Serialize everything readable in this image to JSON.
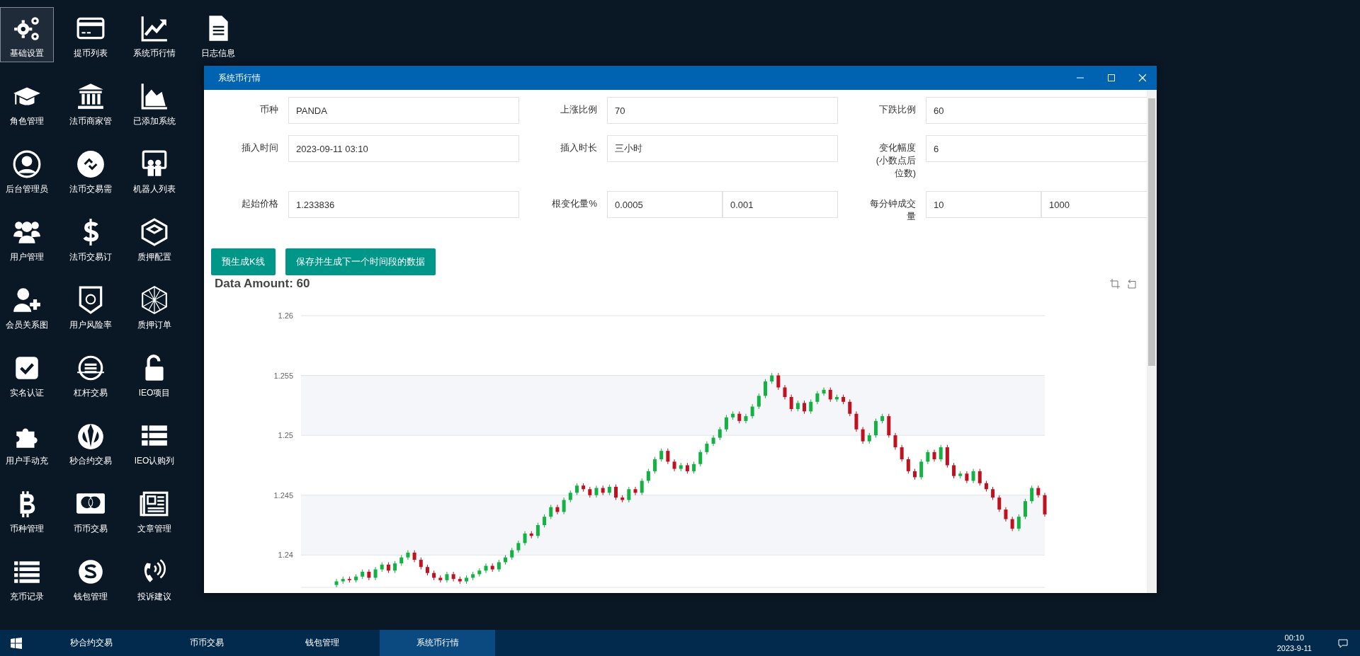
{
  "desktop_icons": [
    [
      {
        "label": "基础设置",
        "selected": true
      },
      {
        "label": "提币列表",
        "selected": false
      },
      {
        "label": "系统币行情",
        "selected": false
      },
      {
        "label": "日志信息",
        "selected": false
      }
    ],
    [
      {
        "label": "角色管理",
        "selected": false
      },
      {
        "label": "法币商家管",
        "selected": false
      },
      {
        "label": "已添加系统",
        "selected": false
      }
    ],
    [
      {
        "label": "后台管理员",
        "selected": false
      },
      {
        "label": "法币交易需",
        "selected": false
      },
      {
        "label": "机器人列表",
        "selected": false
      }
    ],
    [
      {
        "label": "用户管理",
        "selected": false
      },
      {
        "label": "法币交易订",
        "selected": false
      },
      {
        "label": "质押配置",
        "selected": false
      }
    ],
    [
      {
        "label": "会员关系图",
        "selected": false
      },
      {
        "label": "用户风险率",
        "selected": false
      },
      {
        "label": "质押订单",
        "selected": false
      }
    ],
    [
      {
        "label": "实名认证",
        "selected": false
      },
      {
        "label": "杠杆交易",
        "selected": false
      },
      {
        "label": "IEO项目",
        "selected": false
      }
    ],
    [
      {
        "label": "用户手动充",
        "selected": false
      },
      {
        "label": "秒合约交易",
        "selected": false
      },
      {
        "label": "IEO认购列",
        "selected": false
      }
    ],
    [
      {
        "label": "币种管理",
        "selected": false
      },
      {
        "label": "币币交易",
        "selected": false
      },
      {
        "label": "文章管理",
        "selected": false
      }
    ],
    [
      {
        "label": "充币记录",
        "selected": false
      },
      {
        "label": "钱包管理",
        "selected": false
      },
      {
        "label": "投诉建议",
        "selected": false
      }
    ]
  ],
  "window": {
    "title": "系统币行情",
    "form": [
      [
        {
          "label": "币种",
          "values": [
            "PANDA"
          ]
        },
        {
          "label": "上涨比例",
          "values": [
            "70"
          ]
        },
        {
          "label": "下跌比例",
          "values": [
            "60"
          ]
        }
      ],
      [
        {
          "label": "插入时间",
          "values": [
            "2023-09-11 03:10"
          ]
        },
        {
          "label": "插入时长",
          "values": [
            "三小时"
          ]
        },
        {
          "label": "变化幅度 (小数点后位数)",
          "values": [
            "6"
          ]
        }
      ],
      [
        {
          "label": "起始价格",
          "values": [
            "1.233836"
          ]
        },
        {
          "label": "根变化量%",
          "values": [
            "0.0005",
            "0.001"
          ]
        },
        {
          "label": "每分钟成交量",
          "values": [
            "10",
            "1000"
          ]
        }
      ]
    ],
    "buttons": [
      "预生成K线",
      "保存并生成下一个时间段的数据"
    ],
    "chart_data": {
      "type": "candlestick",
      "title": "Data Amount: 60",
      "grid": true,
      "ylim": [
        1.2373,
        1.26
      ],
      "yticks": [
        1.24,
        1.245,
        1.25,
        1.255,
        1.26
      ],
      "bands": [
        {
          "axis": "y",
          "from": 1.25,
          "to": 1.255
        },
        {
          "axis": "y",
          "from": 1.24,
          "to": 1.245
        }
      ],
      "ohlc": [
        [
          1.2375,
          1.238,
          1.2373,
          1.2378
        ],
        [
          1.2378,
          1.2382,
          1.2376,
          1.238
        ],
        [
          1.238,
          1.2382,
          1.2377,
          1.2379
        ],
        [
          1.2379,
          1.2384,
          1.2377,
          1.2382
        ],
        [
          1.2382,
          1.2388,
          1.238,
          1.2386
        ],
        [
          1.2386,
          1.2388,
          1.2379,
          1.2381
        ],
        [
          1.2381,
          1.239,
          1.2379,
          1.2388
        ],
        [
          1.2388,
          1.2394,
          1.2386,
          1.2392
        ],
        [
          1.2392,
          1.2394,
          1.2385,
          1.2387
        ],
        [
          1.2387,
          1.2395,
          1.2385,
          1.2393
        ],
        [
          1.2393,
          1.24,
          1.2391,
          1.2398
        ],
        [
          1.2398,
          1.2404,
          1.2396,
          1.2402
        ],
        [
          1.2402,
          1.2404,
          1.2394,
          1.2396
        ],
        [
          1.2396,
          1.2398,
          1.2388,
          1.239
        ],
        [
          1.239,
          1.2392,
          1.2383,
          1.2385
        ],
        [
          1.2385,
          1.2387,
          1.2379,
          1.2381
        ],
        [
          1.2381,
          1.2383,
          1.2377,
          1.2379
        ],
        [
          1.2379,
          1.2386,
          1.2377,
          1.2384
        ],
        [
          1.2384,
          1.2386,
          1.2378,
          1.238
        ],
        [
          1.238,
          1.2382,
          1.2376,
          1.2378
        ],
        [
          1.2378,
          1.2383,
          1.2376,
          1.2381
        ],
        [
          1.2381,
          1.2386,
          1.2379,
          1.2384
        ],
        [
          1.2384,
          1.2389,
          1.2382,
          1.2387
        ],
        [
          1.2387,
          1.2393,
          1.2385,
          1.2391
        ],
        [
          1.2391,
          1.2393,
          1.2386,
          1.2388
        ],
        [
          1.2388,
          1.2396,
          1.2386,
          1.2394
        ],
        [
          1.2394,
          1.24,
          1.2392,
          1.2398
        ],
        [
          1.2398,
          1.2406,
          1.2396,
          1.2404
        ],
        [
          1.2404,
          1.2412,
          1.2402,
          1.241
        ],
        [
          1.241,
          1.242,
          1.2408,
          1.2418
        ],
        [
          1.2418,
          1.242,
          1.2414,
          1.2416
        ],
        [
          1.2416,
          1.2427,
          1.2414,
          1.2425
        ],
        [
          1.2425,
          1.2434,
          1.2423,
          1.2432
        ],
        [
          1.2432,
          1.2442,
          1.243,
          1.244
        ],
        [
          1.244,
          1.2442,
          1.2434,
          1.2436
        ],
        [
          1.2436,
          1.2448,
          1.2434,
          1.2446
        ],
        [
          1.2446,
          1.2454,
          1.2444,
          1.2452
        ],
        [
          1.2452,
          1.246,
          1.245,
          1.2458
        ],
        [
          1.2458,
          1.246,
          1.2453,
          1.2455
        ],
        [
          1.2455,
          1.2457,
          1.2448,
          1.245
        ],
        [
          1.245,
          1.2458,
          1.2448,
          1.2456
        ],
        [
          1.2456,
          1.2458,
          1.245,
          1.2452
        ],
        [
          1.2452,
          1.2459,
          1.245,
          1.2457
        ],
        [
          1.2457,
          1.2459,
          1.2446,
          1.2448
        ],
        [
          1.2448,
          1.245,
          1.2444,
          1.2446
        ],
        [
          1.2446,
          1.2457,
          1.2444,
          1.2455
        ],
        [
          1.2455,
          1.2457,
          1.245,
          1.2452
        ],
        [
          1.2452,
          1.2464,
          1.245,
          1.2462
        ],
        [
          1.2462,
          1.2472,
          1.246,
          1.247
        ],
        [
          1.247,
          1.2482,
          1.2468,
          1.248
        ],
        [
          1.248,
          1.2489,
          1.2478,
          1.2487
        ],
        [
          1.2487,
          1.2489,
          1.2476,
          1.2478
        ],
        [
          1.2478,
          1.248,
          1.247,
          1.2472
        ],
        [
          1.2472,
          1.2477,
          1.247,
          1.2475
        ],
        [
          1.2475,
          1.2477,
          1.2468,
          1.247
        ],
        [
          1.247,
          1.2478,
          1.2468,
          1.2476
        ],
        [
          1.2476,
          1.2488,
          1.2474,
          1.2486
        ],
        [
          1.2486,
          1.2495,
          1.2484,
          1.2493
        ],
        [
          1.2493,
          1.25,
          1.2491,
          1.2498
        ],
        [
          1.2498,
          1.2507,
          1.2496,
          1.2505
        ],
        [
          1.2505,
          1.2517,
          1.2503,
          1.2515
        ],
        [
          1.2515,
          1.252,
          1.2513,
          1.2518
        ],
        [
          1.2518,
          1.252,
          1.251,
          1.2512
        ],
        [
          1.2512,
          1.2518,
          1.251,
          1.2516
        ],
        [
          1.2516,
          1.2526,
          1.2514,
          1.2524
        ],
        [
          1.2524,
          1.2535,
          1.2522,
          1.2533
        ],
        [
          1.2533,
          1.2547,
          1.2531,
          1.2545
        ],
        [
          1.2545,
          1.2552,
          1.2543,
          1.255
        ],
        [
          1.255,
          1.2552,
          1.2538,
          1.254
        ],
        [
          1.254,
          1.2542,
          1.253,
          1.2532
        ],
        [
          1.2532,
          1.2534,
          1.252,
          1.2522
        ],
        [
          1.2522,
          1.2529,
          1.252,
          1.2527
        ],
        [
          1.2527,
          1.2529,
          1.2518,
          1.252
        ],
        [
          1.252,
          1.253,
          1.2518,
          1.2528
        ],
        [
          1.2528,
          1.2537,
          1.2526,
          1.2535
        ],
        [
          1.2535,
          1.254,
          1.2533,
          1.2538
        ],
        [
          1.2538,
          1.254,
          1.2528,
          1.253
        ],
        [
          1.253,
          1.2534,
          1.2528,
          1.2532
        ],
        [
          1.2532,
          1.2534,
          1.2526,
          1.2528
        ],
        [
          1.2528,
          1.253,
          1.2516,
          1.2518
        ],
        [
          1.2518,
          1.252,
          1.2503,
          1.2505
        ],
        [
          1.2505,
          1.2507,
          1.2493,
          1.2495
        ],
        [
          1.2495,
          1.2502,
          1.2493,
          1.25
        ],
        [
          1.25,
          1.2514,
          1.2498,
          1.2512
        ],
        [
          1.2512,
          1.2518,
          1.251,
          1.2516
        ],
        [
          1.2516,
          1.2518,
          1.2498,
          1.25
        ],
        [
          1.25,
          1.2502,
          1.2488,
          1.249
        ],
        [
          1.249,
          1.2492,
          1.2478,
          1.248
        ],
        [
          1.248,
          1.2482,
          1.2468,
          1.247
        ],
        [
          1.247,
          1.2472,
          1.2463,
          1.2465
        ],
        [
          1.2465,
          1.248,
          1.2463,
          1.2478
        ],
        [
          1.2478,
          1.2488,
          1.2476,
          1.2486
        ],
        [
          1.2486,
          1.2488,
          1.2478,
          1.248
        ],
        [
          1.248,
          1.2492,
          1.2478,
          1.249
        ],
        [
          1.249,
          1.2492,
          1.2473,
          1.2475
        ],
        [
          1.2475,
          1.2477,
          1.2464,
          1.2466
        ],
        [
          1.2466,
          1.247,
          1.2464,
          1.2468
        ],
        [
          1.2468,
          1.247,
          1.246,
          1.2462
        ],
        [
          1.2462,
          1.2472,
          1.246,
          1.247
        ],
        [
          1.247,
          1.2472,
          1.2458,
          1.246
        ],
        [
          1.246,
          1.2462,
          1.2453,
          1.2455
        ],
        [
          1.2455,
          1.2457,
          1.2446,
          1.2448
        ],
        [
          1.2448,
          1.245,
          1.2436,
          1.2438
        ],
        [
          1.2438,
          1.244,
          1.2428,
          1.243
        ],
        [
          1.243,
          1.2432,
          1.242,
          1.2422
        ],
        [
          1.2422,
          1.2434,
          1.242,
          1.2432
        ],
        [
          1.2432,
          1.2447,
          1.243,
          1.2445
        ],
        [
          1.2445,
          1.2458,
          1.2443,
          1.2456
        ],
        [
          1.2456,
          1.2458,
          1.2448,
          1.245
        ],
        [
          1.245,
          1.2452,
          1.2432,
          1.2434
        ]
      ]
    }
  },
  "taskbar": {
    "items": [
      {
        "label": "秒合约交易",
        "selected": false
      },
      {
        "label": "币币交易",
        "selected": false
      },
      {
        "label": "钱包管理",
        "selected": false
      },
      {
        "label": "系统币行情",
        "selected": true
      }
    ],
    "time": "00:10",
    "date": "2023-9-11"
  }
}
